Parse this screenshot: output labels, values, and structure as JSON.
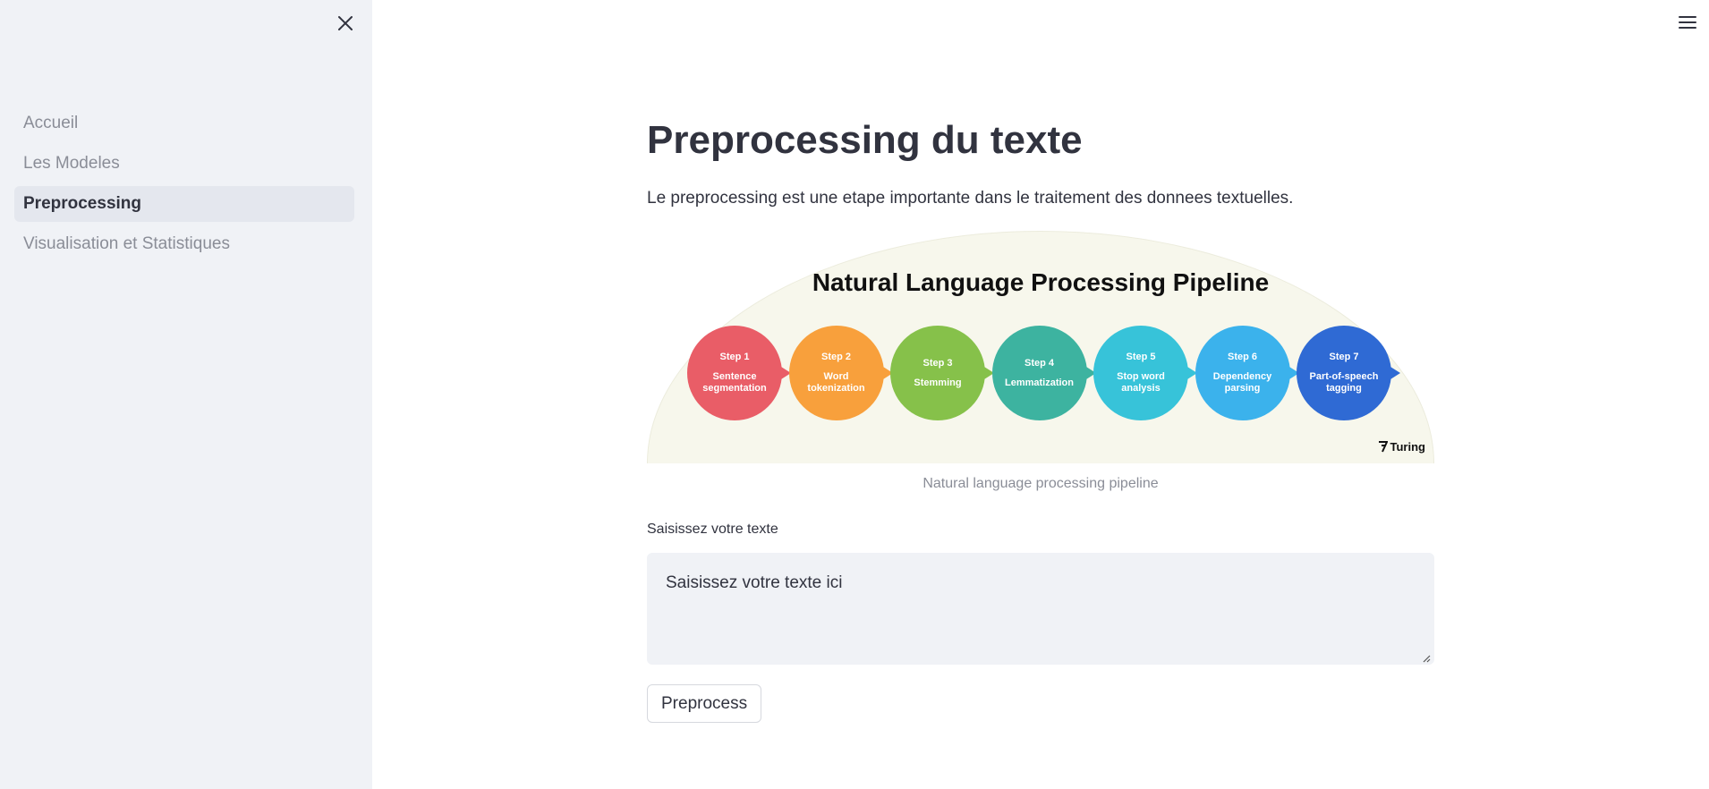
{
  "sidebar": {
    "close_icon": "close-icon",
    "items": [
      {
        "label": "Accueil",
        "active": false
      },
      {
        "label": "Les Modeles",
        "active": false
      },
      {
        "label": "Preprocessing",
        "active": true
      },
      {
        "label": "Visualisation et Statistiques",
        "active": false
      }
    ]
  },
  "header": {
    "menu_icon": "hamburger-menu-icon"
  },
  "main": {
    "title": "Preprocessing du texte",
    "intro": "Le preprocessing est une etape importante dans le traitement des donnees textuelles.",
    "image": {
      "title": "Natural Language Processing Pipeline",
      "brand": "Turing",
      "steps": [
        {
          "num": "Step 1",
          "label": "Sentence segmentation",
          "color": "#e95d67"
        },
        {
          "num": "Step 2",
          "label": "Word tokenization",
          "color": "#f8a03c"
        },
        {
          "num": "Step 3",
          "label": "Stemming",
          "color": "#86c14a"
        },
        {
          "num": "Step 4",
          "label": "Lemmatization",
          "color": "#3db3a0"
        },
        {
          "num": "Step 5",
          "label": "Stop word analysis",
          "color": "#37c3d9"
        },
        {
          "num": "Step 6",
          "label": "Dependency parsing",
          "color": "#3bb2ec"
        },
        {
          "num": "Step 7",
          "label": "Part-of-speech tagging",
          "color": "#2f6ad4"
        }
      ]
    },
    "caption": "Natural language processing pipeline",
    "input": {
      "label": "Saisissez votre texte",
      "value": "",
      "placeholder": "Saisissez votre texte ici"
    },
    "button_label": "Preprocess"
  }
}
